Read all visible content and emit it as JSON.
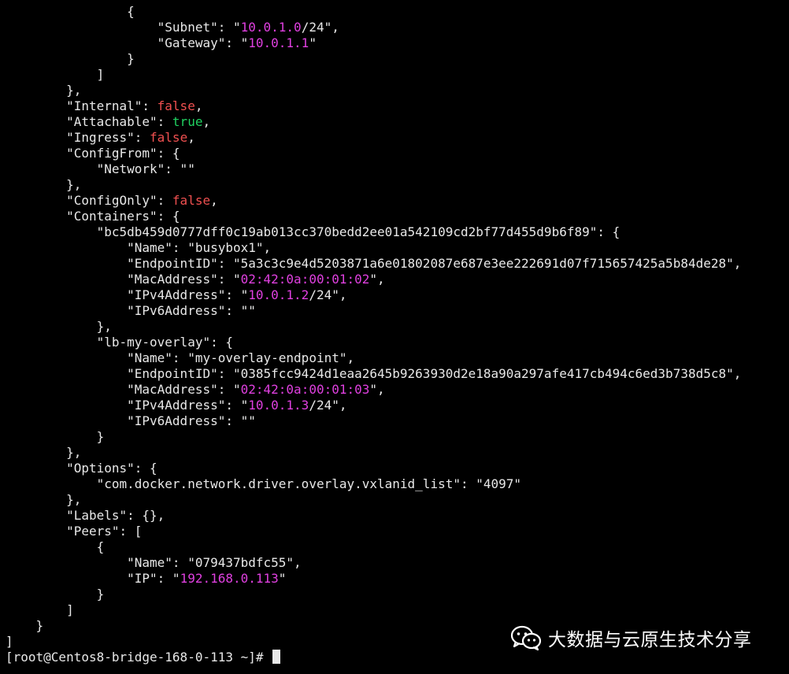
{
  "terminal": {
    "lines": [
      [
        {
          "t": "                {"
        }
      ],
      [
        {
          "t": "                    \"Subnet\": \""
        },
        {
          "t": "10.0.1.0",
          "c": "pink"
        },
        {
          "t": "/24\","
        }
      ],
      [
        {
          "t": "                    \"Gateway\": \""
        },
        {
          "t": "10.0.1.1",
          "c": "pink"
        },
        {
          "t": "\""
        }
      ],
      [
        {
          "t": "                }"
        }
      ],
      [
        {
          "t": "            ]"
        }
      ],
      [
        {
          "t": "        },"
        }
      ],
      [
        {
          "t": "        \"Internal\": "
        },
        {
          "t": "false",
          "c": "red"
        },
        {
          "t": ","
        }
      ],
      [
        {
          "t": "        \"Attachable\": "
        },
        {
          "t": "true",
          "c": "green"
        },
        {
          "t": ","
        }
      ],
      [
        {
          "t": "        \"Ingress\": "
        },
        {
          "t": "false",
          "c": "red"
        },
        {
          "t": ","
        }
      ],
      [
        {
          "t": "        \"ConfigFrom\": {"
        }
      ],
      [
        {
          "t": "            \"Network\": \"\""
        }
      ],
      [
        {
          "t": "        },"
        }
      ],
      [
        {
          "t": "        \"ConfigOnly\": "
        },
        {
          "t": "false",
          "c": "red"
        },
        {
          "t": ","
        }
      ],
      [
        {
          "t": "        \"Containers\": {"
        }
      ],
      [
        {
          "t": "            \"bc5db459d0777dff0c19ab013cc370bedd2ee01a542109cd2bf77d455d9b6f89\": {"
        }
      ],
      [
        {
          "t": "                \"Name\": \"busybox1\","
        }
      ],
      [
        {
          "t": "                \"EndpointID\": \"5a3c3c9e4d5203871a6e01802087e687e3ee222691d07f715657425a5b84de28\","
        }
      ],
      [
        {
          "t": "                \"MacAddress\": \""
        },
        {
          "t": "02:42:0a:00:01:02",
          "c": "pink"
        },
        {
          "t": "\","
        }
      ],
      [
        {
          "t": "                \"IPv4Address\": \""
        },
        {
          "t": "10.0.1.2",
          "c": "pink"
        },
        {
          "t": "/24\","
        }
      ],
      [
        {
          "t": "                \"IPv6Address\": \"\""
        }
      ],
      [
        {
          "t": "            },"
        }
      ],
      [
        {
          "t": "            \"lb-my-overlay\": {"
        }
      ],
      [
        {
          "t": "                \"Name\": \"my-overlay-endpoint\","
        }
      ],
      [
        {
          "t": "                \"EndpointID\": \"0385fcc9424d1eaa2645b9263930d2e18a90a297afe417cb494c6ed3b738d5c8\","
        }
      ],
      [
        {
          "t": "                \"MacAddress\": \""
        },
        {
          "t": "02:42:0a:00:01:03",
          "c": "pink"
        },
        {
          "t": "\","
        }
      ],
      [
        {
          "t": "                \"IPv4Address\": \""
        },
        {
          "t": "10.0.1.3",
          "c": "pink"
        },
        {
          "t": "/24\","
        }
      ],
      [
        {
          "t": "                \"IPv6Address\": \"\""
        }
      ],
      [
        {
          "t": "            }"
        }
      ],
      [
        {
          "t": "        },"
        }
      ],
      [
        {
          "t": "        \"Options\": {"
        }
      ],
      [
        {
          "t": "            \"com.docker.network.driver.overlay.vxlanid_list\": \"4097\""
        }
      ],
      [
        {
          "t": "        },"
        }
      ],
      [
        {
          "t": "        \"Labels\": {},"
        }
      ],
      [
        {
          "t": "        \"Peers\": ["
        }
      ],
      [
        {
          "t": "            {"
        }
      ],
      [
        {
          "t": "                \"Name\": \"079437bdfc55\","
        }
      ],
      [
        {
          "t": "                \"IP\": \""
        },
        {
          "t": "192.168.0.113",
          "c": "pink"
        },
        {
          "t": "\""
        }
      ],
      [
        {
          "t": "            }"
        }
      ],
      [
        {
          "t": "        ]"
        }
      ],
      [
        {
          "t": "    }"
        }
      ],
      [
        {
          "t": "]"
        }
      ]
    ],
    "prompt": "[root@Centos8-bridge-168-0-113 ~]# "
  },
  "watermark": {
    "icon": "wechat-icon",
    "text": "大数据与云原生技术分享"
  },
  "colors": {
    "background": "#000000",
    "foreground": "#e8e8e8",
    "pink": "#e040e0",
    "red": "#f05050",
    "green": "#20d060"
  }
}
